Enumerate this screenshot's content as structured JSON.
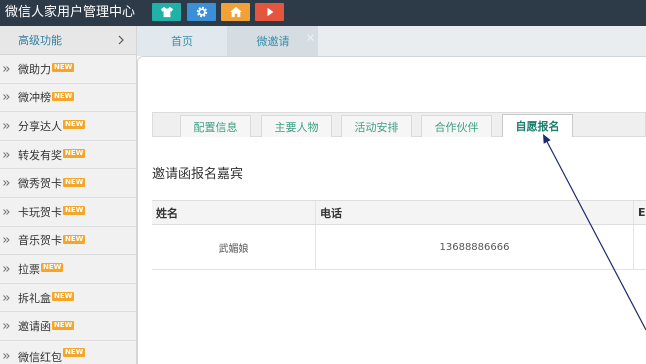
{
  "header": {
    "title": "微信人家用户管理中心",
    "buttons": [
      {
        "icon": "shirt-icon",
        "color": "#22b1a6"
      },
      {
        "icon": "gear-icon",
        "color": "#3b8fd6"
      },
      {
        "icon": "home-icon",
        "color": "#f2a136"
      },
      {
        "icon": "play-icon",
        "color": "#e4553f"
      }
    ]
  },
  "sidebar": {
    "section_label": "高级功能",
    "section_icon": "chevron-right-icon",
    "item_icon": "double-chevron-right-icon",
    "items": [
      {
        "label": "微助力",
        "badge": "NEW"
      },
      {
        "label": "微冲榜",
        "badge": "NEW"
      },
      {
        "label": "分享达人",
        "badge": "NEW"
      },
      {
        "label": "转发有奖",
        "badge": "NEW"
      },
      {
        "label": "微秀贺卡",
        "badge": "NEW"
      },
      {
        "label": "卡玩贺卡",
        "badge": "NEW"
      },
      {
        "label": "音乐贺卡",
        "badge": "NEW"
      },
      {
        "label": "拉票",
        "badge": "NEW"
      },
      {
        "label": "拆礼盒",
        "badge": "NEW"
      },
      {
        "label": "邀请函",
        "badge": "NEW"
      },
      {
        "label": "微信红包",
        "badge": "NEW"
      }
    ]
  },
  "tabs": [
    {
      "label": "首页"
    },
    {
      "label": "微邀请",
      "close_icon": "close-icon"
    }
  ],
  "content": {
    "subtabs": [
      "配置信息",
      "主要人物",
      "活动安排",
      "合作伙伴",
      "自愿报名"
    ],
    "active_subtab": "自愿报名",
    "section_title": "邀请函报名嘉宾",
    "table": {
      "columns": [
        "姓名",
        "电话",
        "E"
      ],
      "rows": [
        [
          "武媚娘",
          "13688886666",
          ""
        ]
      ]
    }
  },
  "colors": {
    "header_bg": "#2d3b49",
    "accent": "#3d9f84",
    "badge": "#f4a62a",
    "annotation_arrow": "#1d2a6b"
  }
}
